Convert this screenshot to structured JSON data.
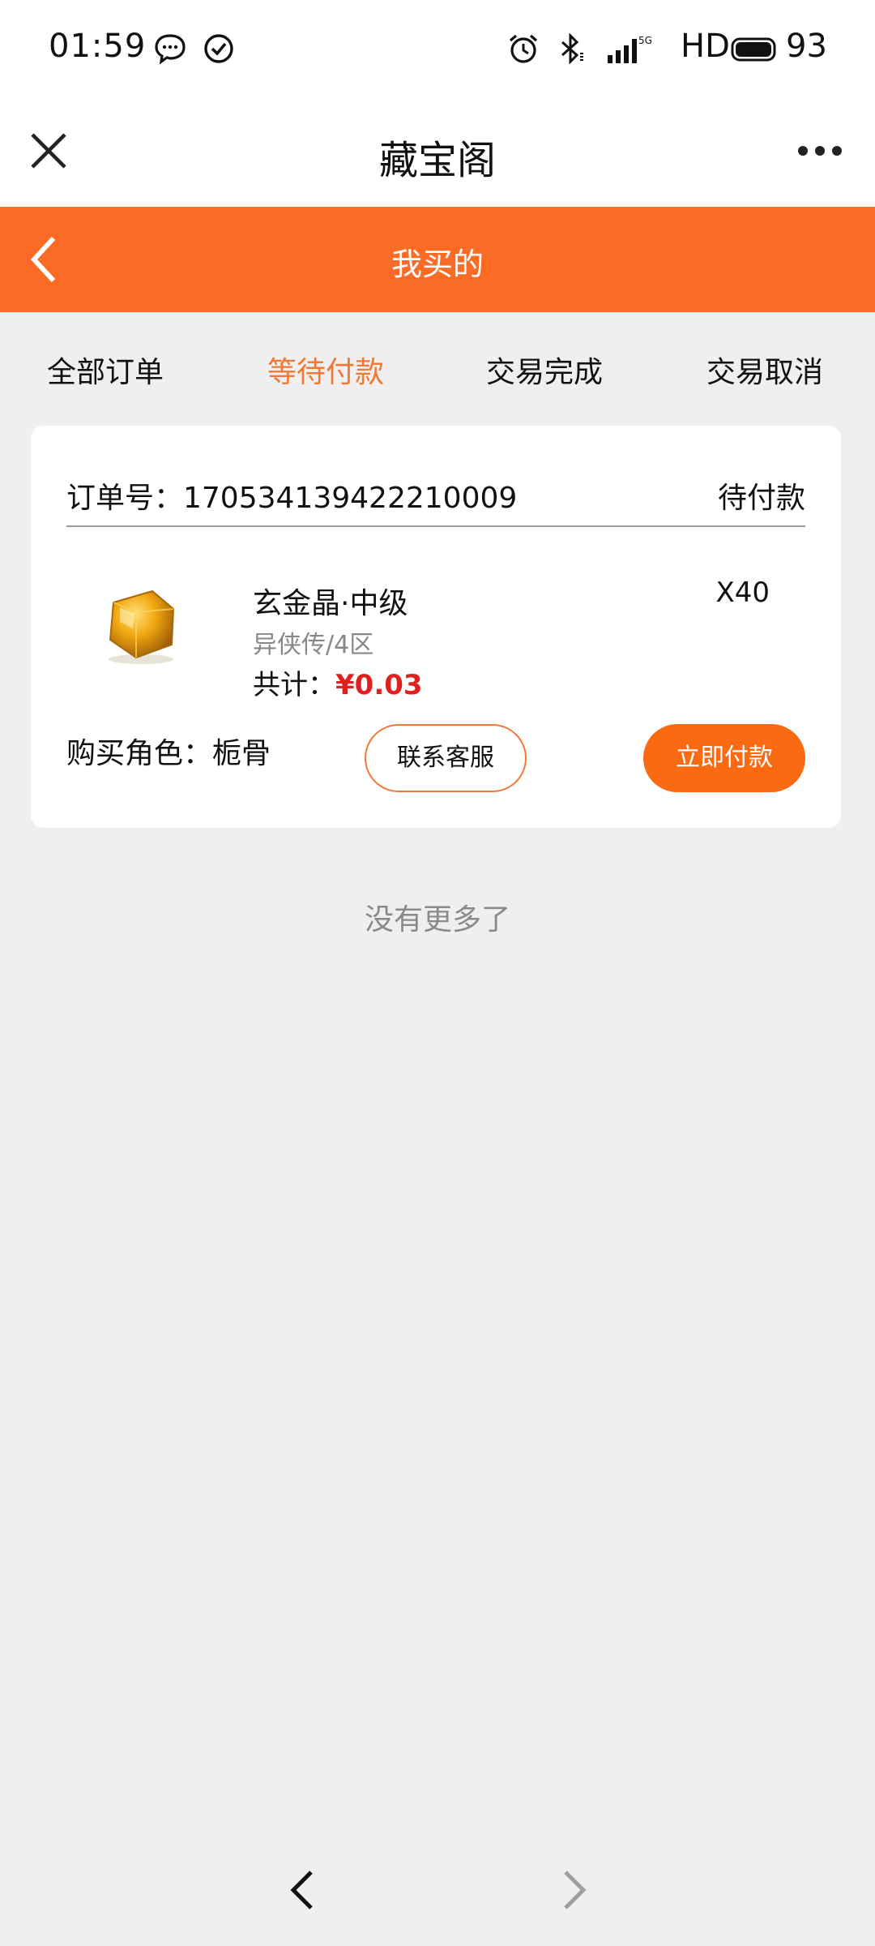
{
  "status_bar": {
    "time": "01:59",
    "icons": [
      "chat-bubble-icon",
      "check-circle-icon",
      "alarm-icon",
      "bluetooth-icon",
      "signal-icon"
    ],
    "network_label": "HD",
    "battery": "93"
  },
  "title_bar": {
    "title": "藏宝阁",
    "close_icon": "close-icon",
    "more_icon": "more-icon"
  },
  "header": {
    "title": "我买的",
    "back_icon": "chevron-left-icon",
    "background_color": "#fa6b25"
  },
  "tabs": [
    {
      "label": "全部订单",
      "active": false
    },
    {
      "label": "等待付款",
      "active": true
    },
    {
      "label": "交易完成",
      "active": false
    },
    {
      "label": "交易取消",
      "active": false
    }
  ],
  "order": {
    "order_number_label": "订单号：170534139422210009",
    "status": "待付款",
    "item": {
      "name": "玄金晶·中级",
      "server": "异侠传/4区",
      "total_label": "共计：",
      "total_price": "¥0.03",
      "quantity": "X40"
    },
    "buyer_label": "购买角色：栀骨",
    "contact_button": "联系客服",
    "pay_button": "立即付款"
  },
  "footer_text": "没有更多了",
  "colors": {
    "accent": "#fa6b25",
    "active_tab": "#f07a35",
    "price": "#e0201f"
  }
}
